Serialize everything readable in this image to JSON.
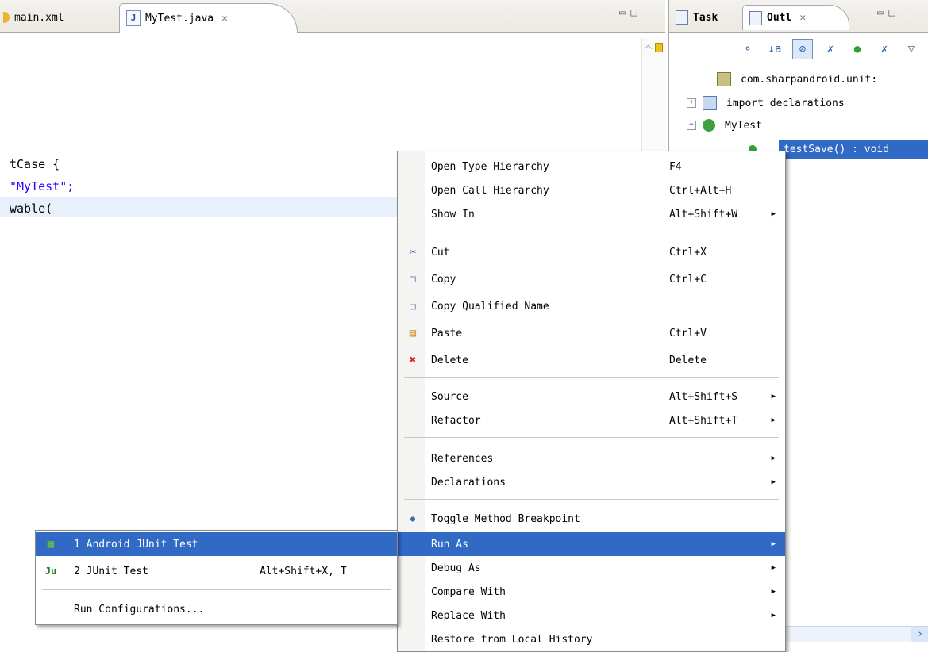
{
  "editor": {
    "tabs": [
      {
        "label": "main.xml"
      },
      {
        "label": "MyTest.java",
        "close": "✕"
      }
    ],
    "file_icon": "J",
    "code_lines": [
      "tCase {",
      "\"MyTest\";",
      "wable("
    ]
  },
  "outline_view": {
    "tabs": [
      {
        "label": "Task"
      },
      {
        "label": "Outl",
        "close": "✕"
      }
    ],
    "tree": [
      {
        "label": "com.sharpandroid.unit:"
      },
      {
        "label": "import declarations"
      },
      {
        "label": "MyTest"
      },
      {
        "label": "testSave() : void"
      }
    ]
  },
  "context_menu": {
    "items": [
      {
        "label": "Open Type Hierarchy",
        "accel": "F4"
      },
      {
        "label": "Open Call Hierarchy",
        "accel": "Ctrl+Alt+H"
      },
      {
        "label": "Show In",
        "accel": "Alt+Shift+W"
      },
      {
        "label": "Cut",
        "accel": "Ctrl+X"
      },
      {
        "label": "Copy",
        "accel": "Ctrl+C"
      },
      {
        "label": "Copy Qualified Name",
        "accel": ""
      },
      {
        "label": "Paste",
        "accel": "Ctrl+V"
      },
      {
        "label": "Delete",
        "accel": "Delete"
      },
      {
        "label": "Source",
        "accel": "Alt+Shift+S"
      },
      {
        "label": "Refactor",
        "accel": "Alt+Shift+T"
      },
      {
        "label": "References",
        "accel": ""
      },
      {
        "label": "Declarations",
        "accel": ""
      },
      {
        "label": "Toggle Method Breakpoint",
        "accel": ""
      },
      {
        "label": "Run As",
        "accel": ""
      },
      {
        "label": "Debug As",
        "accel": ""
      },
      {
        "label": "Compare With",
        "accel": ""
      },
      {
        "label": "Replace With",
        "accel": ""
      },
      {
        "label": "Restore from Local History",
        "accel": ""
      }
    ]
  },
  "run_as_submenu": {
    "items": [
      {
        "label": "1 Android JUnit Test",
        "accel": ""
      },
      {
        "label": "2 JUnit Test",
        "accel": "Alt+Shift+X, T"
      },
      {
        "label": "Run Configurations...",
        "accel": ""
      }
    ],
    "junit_icon": "Ju"
  },
  "colors": {
    "selection": "#316ac5",
    "string_literal": "#2a00ff",
    "current_line": "#e8f0fb"
  }
}
